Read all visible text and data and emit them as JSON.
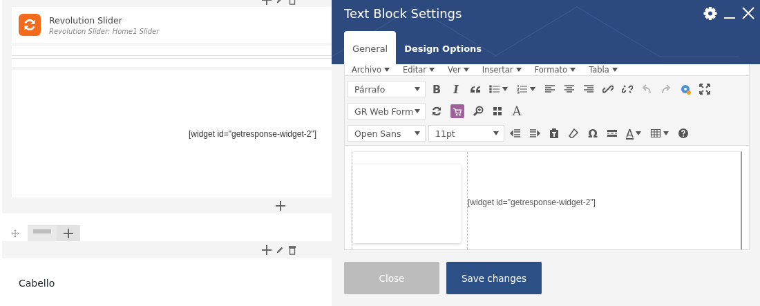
{
  "builder": {
    "slider_element": {
      "title": "Revolution Slider",
      "subtitle": "Revolution Slider: Home1 Slider"
    },
    "widget_text": "[widget id=\"getresponse-widget-2\"]",
    "section_title": "Cabello"
  },
  "modal": {
    "title": "Text Block Settings",
    "tabs": [
      {
        "label": "General",
        "selected": true
      },
      {
        "label": "Design Options",
        "selected": false
      }
    ],
    "menubar": [
      "Archivo",
      "Editar",
      "Ver",
      "Insertar",
      "Formato",
      "Tabla"
    ],
    "toolbar_rows": [
      [
        {
          "kind": "select",
          "text": "Párrafo",
          "disabled": false
        },
        {
          "kind": "glyph",
          "text": "B",
          "disabled": false
        },
        {
          "kind": "italic",
          "text": "I",
          "disabled": false
        },
        {
          "kind": "quote",
          "disabled": false
        },
        {
          "kind": "bullet-list",
          "disabled": false
        },
        {
          "kind": "numbered-list",
          "disabled": false
        },
        {
          "kind": "align-left",
          "disabled": false
        },
        {
          "kind": "align-center",
          "disabled": false
        },
        {
          "kind": "align-right",
          "disabled": false
        },
        {
          "kind": "link",
          "disabled": false
        },
        {
          "kind": "unlink",
          "disabled": false
        },
        {
          "kind": "undo",
          "disabled": true
        },
        {
          "kind": "redo",
          "disabled": true
        },
        {
          "kind": "gears",
          "disabled": false
        },
        {
          "kind": "fullscreen",
          "disabled": false
        }
      ],
      [
        {
          "kind": "select",
          "text": "GR Web Form",
          "disabled": false
        },
        {
          "kind": "refresh",
          "disabled": false
        },
        {
          "kind": "cart",
          "disabled": false
        },
        {
          "kind": "zoom",
          "disabled": false
        },
        {
          "kind": "grid",
          "disabled": false
        },
        {
          "kind": "serif-glyph",
          "text": "A",
          "disabled": false
        }
      ],
      [
        {
          "kind": "select",
          "text": "Open Sans",
          "disabled": false
        },
        {
          "kind": "wide-select",
          "text": "11pt",
          "disabled": false
        },
        {
          "kind": "outdent",
          "disabled": false
        },
        {
          "kind": "indent",
          "disabled": false
        },
        {
          "kind": "paste",
          "disabled": false
        },
        {
          "kind": "eraser",
          "disabled": false
        },
        {
          "kind": "glyph",
          "text": "Ω",
          "disabled": false
        },
        {
          "kind": "page-break",
          "disabled": false
        },
        {
          "kind": "text-color",
          "text": "A",
          "disabled": false
        },
        {
          "kind": "table",
          "disabled": false
        },
        {
          "kind": "help",
          "disabled": false
        }
      ]
    ],
    "content_text": "[widget id=\"getresponse-widget-2\"]",
    "buttons": [
      {
        "label": "Close",
        "kind": "secondary"
      },
      {
        "label": "Save changes",
        "kind": "primary"
      }
    ]
  }
}
